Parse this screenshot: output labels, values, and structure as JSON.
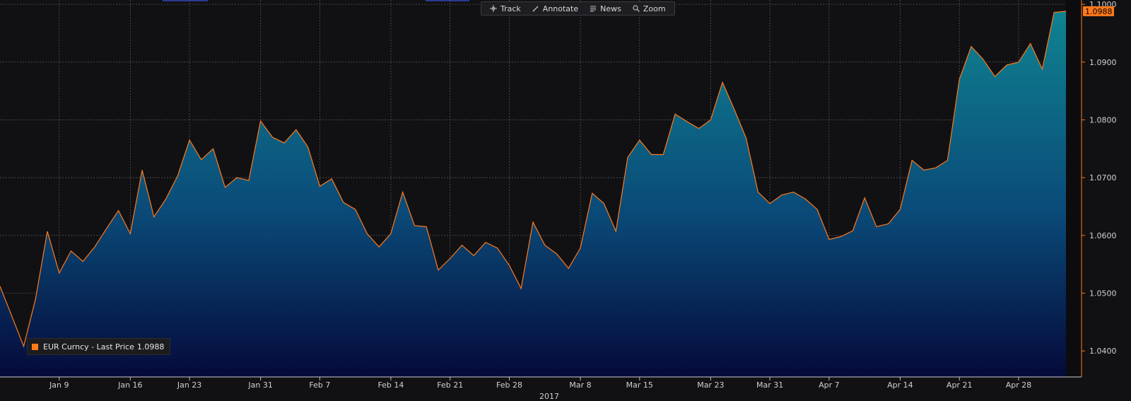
{
  "toolbar": {
    "items": [
      {
        "label": "Track",
        "icon": "crosshair-icon"
      },
      {
        "label": "Annotate",
        "icon": "pencil-icon"
      },
      {
        "label": "News",
        "icon": "news-icon"
      },
      {
        "label": "Zoom",
        "icon": "magnifier-icon"
      }
    ]
  },
  "legend": {
    "series_label": "EUR Curncy - Last Price",
    "last_value": "1.0988"
  },
  "price_tag": "1.0988",
  "year_label": "2017",
  "colors": {
    "background": "#111114",
    "line": "#ff7a1a",
    "fill_top": "#0e7d8c",
    "fill_bottom": "#050a3a",
    "grid": "#5a5a5a",
    "text": "#cfcfcf",
    "axis": "#ff7a1a"
  },
  "chart_data": {
    "type": "area",
    "title": "",
    "xlabel": "2017",
    "ylabel": "",
    "ylim": [
      1.0355,
      1.1005
    ],
    "grid": true,
    "legend_position": "bottom-left",
    "y_ticks": [
      "1.0400",
      "1.0500",
      "1.0600",
      "1.0700",
      "1.0800",
      "1.0900",
      "1.1000"
    ],
    "x_ticks": [
      "Jan 9",
      "Jan 16",
      "Jan 23",
      "Jan 31",
      "Feb 7",
      "Feb 14",
      "Feb 21",
      "Feb 28",
      "Mar 8",
      "Mar 15",
      "Mar 23",
      "Mar 31",
      "Apr 7",
      "Apr 14",
      "Apr 21",
      "Apr 28"
    ],
    "series": [
      {
        "name": "EUR Curncy - Last Price",
        "values": [
          1.0512,
          1.046,
          1.0408,
          1.049,
          1.0607,
          1.0535,
          1.0573,
          1.0555,
          1.058,
          1.0612,
          1.0643,
          1.0603,
          1.0713,
          1.0632,
          1.0663,
          1.0703,
          1.0765,
          1.0731,
          1.075,
          1.0683,
          1.07,
          1.0695,
          1.0798,
          1.077,
          1.076,
          1.0783,
          1.0753,
          1.0685,
          1.0698,
          1.0657,
          1.0645,
          1.0603,
          1.058,
          1.0603,
          1.0675,
          1.0617,
          1.0615,
          1.054,
          1.056,
          1.0583,
          1.0565,
          1.0588,
          1.0578,
          1.0548,
          1.0508,
          1.0623,
          1.0583,
          1.0568,
          1.0543,
          1.0578,
          1.0673,
          1.0655,
          1.0607,
          1.0735,
          1.0765,
          1.074,
          1.074,
          1.081,
          1.0797,
          1.0785,
          1.08,
          1.0865,
          1.0818,
          1.0768,
          1.0675,
          1.0655,
          1.067,
          1.0675,
          1.0663,
          1.0645,
          1.0593,
          1.0598,
          1.0608,
          1.0665,
          1.0615,
          1.062,
          1.0645,
          1.073,
          1.0713,
          1.0717,
          1.073,
          1.087,
          1.0927,
          1.0905,
          1.0875,
          1.0895,
          1.09,
          1.0932,
          1.0888,
          1.0986,
          1.0988
        ]
      }
    ]
  }
}
